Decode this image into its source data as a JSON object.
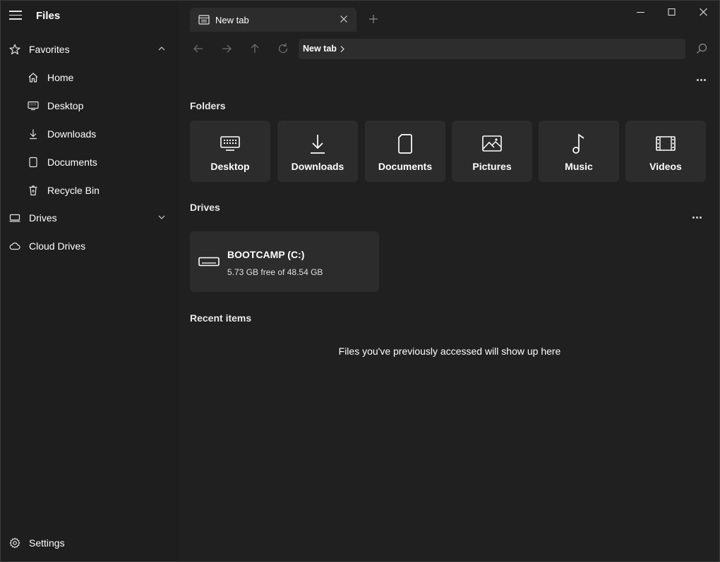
{
  "app": {
    "title": "Files"
  },
  "sidebar": {
    "favorites": {
      "label": "Favorites"
    },
    "items": [
      {
        "label": "Home",
        "icon": "home-icon"
      },
      {
        "label": "Desktop",
        "icon": "desktop-icon"
      },
      {
        "label": "Downloads",
        "icon": "download-icon"
      },
      {
        "label": "Documents",
        "icon": "document-icon"
      },
      {
        "label": "Recycle Bin",
        "icon": "recycle-bin-icon"
      }
    ],
    "drives": {
      "label": "Drives"
    },
    "cloud_drives": {
      "label": "Cloud Drives"
    },
    "settings": {
      "label": "Settings"
    }
  },
  "tabs": [
    {
      "label": "New tab"
    }
  ],
  "address": {
    "crumb": "New tab"
  },
  "sections": {
    "folders": "Folders",
    "drives": "Drives",
    "recent": "Recent items"
  },
  "folders": [
    {
      "label": "Desktop",
      "icon": "desktop-icon"
    },
    {
      "label": "Downloads",
      "icon": "download-icon"
    },
    {
      "label": "Documents",
      "icon": "document-icon"
    },
    {
      "label": "Pictures",
      "icon": "picture-icon"
    },
    {
      "label": "Music",
      "icon": "music-note-icon"
    },
    {
      "label": "Videos",
      "icon": "film-icon"
    }
  ],
  "drives": [
    {
      "name": "BOOTCAMP (C:)",
      "free_text": "5.73 GB free of 48.54 GB",
      "icon": "drive-icon"
    }
  ],
  "recent": {
    "empty_message": "Files you've previously accessed will show up here"
  },
  "colors": {
    "background": "#202020",
    "sidebar": "#1e1e1e",
    "card": "#2c2c2c",
    "text": "#ffffff"
  }
}
